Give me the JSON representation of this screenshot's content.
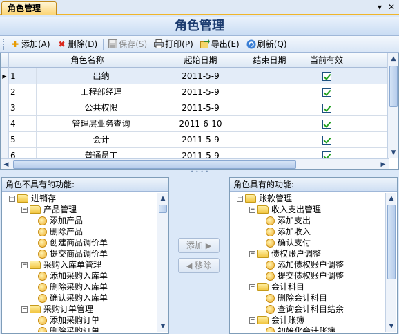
{
  "tab": {
    "label": "角色管理"
  },
  "title": "角色管理",
  "toolbar": {
    "add": "添加(A)",
    "delete": "删除(D)",
    "save": "保存(S)",
    "print": "打印(P)",
    "export": "导出(E)",
    "refresh": "刷新(Q)"
  },
  "grid": {
    "columns": [
      "角色名称",
      "起始日期",
      "结束日期",
      "当前有效"
    ],
    "rows": [
      {
        "id": "1",
        "name": "出纳",
        "start": "2011-5-9",
        "end": "",
        "active": true
      },
      {
        "id": "2",
        "name": "工程部经理",
        "start": "2011-5-9",
        "end": "",
        "active": true
      },
      {
        "id": "3",
        "name": "公共权限",
        "start": "2011-5-9",
        "end": "",
        "active": true
      },
      {
        "id": "4",
        "name": "管理层业务查询",
        "start": "2011-6-10",
        "end": "",
        "active": true
      },
      {
        "id": "5",
        "name": "会计",
        "start": "2011-5-9",
        "end": "",
        "active": true
      },
      {
        "id": "6",
        "name": "普通员工",
        "start": "2011-5-9",
        "end": "",
        "active": true
      }
    ]
  },
  "left_panel": {
    "title": "角色不具有的功能:",
    "nodes": [
      {
        "label": "进销存",
        "kind": "folder",
        "depth": 0
      },
      {
        "label": "产品管理",
        "kind": "folder",
        "depth": 1
      },
      {
        "label": "添加产品",
        "kind": "leaf",
        "depth": 2
      },
      {
        "label": "删除产品",
        "kind": "leaf",
        "depth": 2
      },
      {
        "label": "创建商品调价单",
        "kind": "leaf",
        "depth": 2
      },
      {
        "label": "提交商品调价单",
        "kind": "leaf",
        "depth": 2
      },
      {
        "label": "采购入库单管理",
        "kind": "folder",
        "depth": 1
      },
      {
        "label": "添加采购入库单",
        "kind": "leaf",
        "depth": 2
      },
      {
        "label": "删除采购入库单",
        "kind": "leaf",
        "depth": 2
      },
      {
        "label": "确认采购入库单",
        "kind": "leaf",
        "depth": 2
      },
      {
        "label": "采购订单管理",
        "kind": "folder",
        "depth": 1
      },
      {
        "label": "添加采购订单",
        "kind": "leaf",
        "depth": 2
      },
      {
        "label": "删除采购订单",
        "kind": "leaf",
        "depth": 2
      }
    ]
  },
  "right_panel": {
    "title": "角色具有的功能:",
    "nodes": [
      {
        "label": "账款管理",
        "kind": "folder",
        "depth": 0
      },
      {
        "label": "收入支出管理",
        "kind": "folder",
        "depth": 1
      },
      {
        "label": "添加支出",
        "kind": "leaf",
        "depth": 2
      },
      {
        "label": "添加收入",
        "kind": "leaf",
        "depth": 2
      },
      {
        "label": "确认支付",
        "kind": "leaf",
        "depth": 2
      },
      {
        "label": "债权账户调整",
        "kind": "folder",
        "depth": 1
      },
      {
        "label": "添加债权账户调整",
        "kind": "leaf",
        "depth": 2
      },
      {
        "label": "提交债权账户调整",
        "kind": "leaf",
        "depth": 2
      },
      {
        "label": "会计科目",
        "kind": "folder",
        "depth": 1
      },
      {
        "label": "删除会计科目",
        "kind": "leaf",
        "depth": 2
      },
      {
        "label": "查询会计科目结余",
        "kind": "leaf",
        "depth": 2
      },
      {
        "label": "会计账簿",
        "kind": "folder",
        "depth": 1
      },
      {
        "label": "初始化会计账簿",
        "kind": "leaf",
        "depth": 2
      }
    ]
  },
  "transfer": {
    "add": "添加",
    "remove": "移除"
  }
}
